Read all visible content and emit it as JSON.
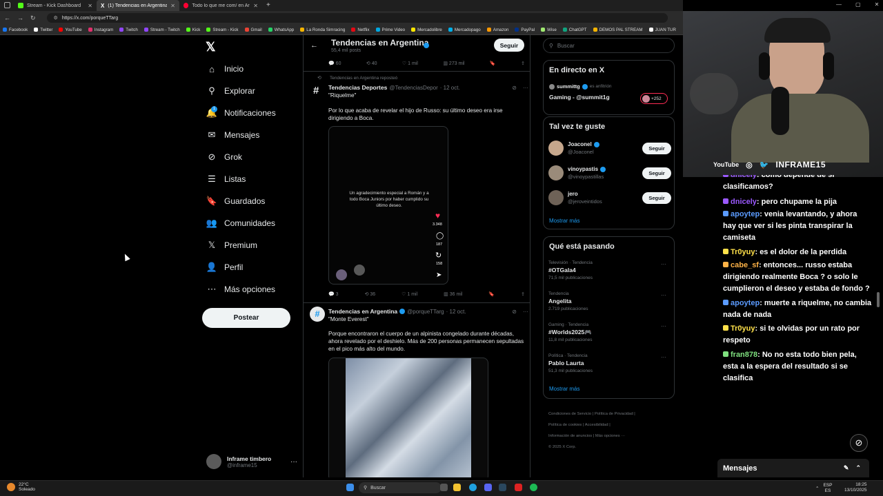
{
  "browser": {
    "tabs": [
      {
        "label": "Stream - Kick Dashboard",
        "color": "#53fc18"
      },
      {
        "label": "(1) Tendencias en Argentina (@p...",
        "color": "#ffffff"
      },
      {
        "label": "Todo lo que me com/ en Argentin...",
        "color": "#ff0033"
      }
    ],
    "new_tab": "+",
    "url": "https://x.com/porqueTTarg",
    "bookmarks": [
      {
        "label": "Facebook",
        "color": "#1877f2"
      },
      {
        "label": "Twitter",
        "color": "#ffffff"
      },
      {
        "label": "YouTube",
        "color": "#ff0000"
      },
      {
        "label": "Instagram",
        "color": "#e1306c"
      },
      {
        "label": "Twitch",
        "color": "#9146ff"
      },
      {
        "label": "Stream - Twitch",
        "color": "#9146ff"
      },
      {
        "label": "Kick",
        "color": "#53fc18"
      },
      {
        "label": "Stream - Kick",
        "color": "#53fc18"
      },
      {
        "label": "Gmail",
        "color": "#ea4335"
      },
      {
        "label": "WhatsApp",
        "color": "#25d366"
      },
      {
        "label": "La Ronda Simracing",
        "color": "#f4b400"
      },
      {
        "label": "Netflix",
        "color": "#e50914"
      },
      {
        "label": "Prime Video",
        "color": "#00a8e1"
      },
      {
        "label": "Mercadolibre",
        "color": "#ffe600"
      },
      {
        "label": "Mercadopago",
        "color": "#00b1ea"
      },
      {
        "label": "Amazon",
        "color": "#ff9900"
      },
      {
        "label": "PayPal",
        "color": "#003087"
      },
      {
        "label": "Wise",
        "color": "#9fe870"
      },
      {
        "label": "ChatGPT",
        "color": "#10a37f"
      },
      {
        "label": "DEMOS PAL STREAM",
        "color": "#f4b400"
      },
      {
        "label": "JUAN TUR",
        "color": "#ffffff"
      }
    ]
  },
  "nav": {
    "items": [
      {
        "label": "Inicio",
        "icon": "⌂"
      },
      {
        "label": "Explorar",
        "icon": "⚲"
      },
      {
        "label": "Notificaciones",
        "icon": "🔔"
      },
      {
        "label": "Mensajes",
        "icon": "✉"
      },
      {
        "label": "Grok",
        "icon": "⊘"
      },
      {
        "label": "Listas",
        "icon": "☰"
      },
      {
        "label": "Guardados",
        "icon": "🔖"
      },
      {
        "label": "Comunidades",
        "icon": "👥"
      },
      {
        "label": "Premium",
        "icon": "𝕏"
      },
      {
        "label": "Perfil",
        "icon": "👤"
      },
      {
        "label": "Más opciones",
        "icon": "⋯"
      }
    ],
    "notification_badge": "1",
    "post_button": "Postear",
    "profile": {
      "name": "Inframe timbero",
      "handle": "@inframe15"
    }
  },
  "timeline": {
    "title": "Tendencias en Argentina",
    "subtitle": "55,4 mil posts",
    "follow": "Seguir",
    "top_actions": {
      "replies": "60",
      "reposts": "40",
      "likes": "1 mil",
      "views": "273 mil"
    },
    "repost_label": "Tendencias en Argentina reposteó",
    "tweet1": {
      "author": "Tendencias Deportes",
      "handle": "@TendenciasDepor",
      "date": "· 12 oct.",
      "topic": "\"Riquelme\"",
      "text": "Por lo que acaba de revelar el hijo de Russo: su último deseo era irse dirigiendo a Boca.",
      "video_caption": "Un agradecimiento especial a Román y a todo Boca Juniors por haber cumplido su último deseo.",
      "video_likes": "3.348",
      "video_comments": "187",
      "video_shares": "158",
      "actions": {
        "replies": "3",
        "reposts": "36",
        "likes": "1 mil",
        "views": "36 mil"
      }
    },
    "tweet2": {
      "author": "Tendencias en Argentina",
      "handle": "@porqueTTarg",
      "date": "· 12 oct.",
      "topic": "\"Monte Everest\"",
      "text": "Porque encontraron el cuerpo de un alpinista congelado durante décadas, ahora revelado por el deshielo. Más de 200 personas permanecen sepultadas en el pico más alto del mundo."
    }
  },
  "sidebar": {
    "search_placeholder": "Buscar",
    "live": {
      "title": "En directo en X",
      "host": "summittg",
      "host_status": "es anfitrión",
      "stream": "Gaming - @summit1g",
      "listeners": "+252"
    },
    "suggest": {
      "title": "Tal vez te guste",
      "users": [
        {
          "name": "Joaconel",
          "handle": "@Joaconel",
          "verified": true
        },
        {
          "name": "vinoypastis",
          "handle": "@vinoypastillas",
          "verified": true
        },
        {
          "name": "jero",
          "handle": "@jeroveintidos",
          "verified": false
        }
      ],
      "follow": "Seguir",
      "more": "Mostrar más"
    },
    "trends": {
      "title": "Qué está pasando",
      "items": [
        {
          "category": "Televisión · Tendencia",
          "name": "#OTGala4",
          "count": "71,5 mil publicaciones"
        },
        {
          "category": "Tendencia",
          "name": "Angelita",
          "count": "2.719 publicaciones"
        },
        {
          "category": "Gaming · Tendencia",
          "name": "#Worlds2025🎮",
          "count": "11,8 mil publicaciones"
        },
        {
          "category": "Política · Tendencia",
          "name": "Pablo Laurta",
          "count": "51,3 mil publicaciones"
        }
      ],
      "more": "Mostrar más"
    },
    "footer": [
      "Condiciones de Servicio",
      "Política de Privacidad",
      "Política de cookies",
      "Accesibilidad",
      "Información de anuncios",
      "Más opciones ···",
      "© 2025 X Corp."
    ]
  },
  "stream": {
    "socials": [
      "YouTube",
      "◎",
      "🐦"
    ],
    "channel": "INFRAME15",
    "chat": [
      {
        "user": "dnicely",
        "color": "#9b59ff",
        "text": ": como depende de si clasificamos?"
      },
      {
        "user": "dnicely",
        "color": "#9b59ff",
        "text": ": pero chupame la pija"
      },
      {
        "user": "apoytep",
        "color": "#5b9bff",
        "text": ": venia levantando, y ahora hay que ver si les pinta transpirar la camiseta"
      },
      {
        "user": "Tr0yuy",
        "color": "#ffe14a",
        "text": ": es el dolor de la perdida"
      },
      {
        "user": "cabe_sf",
        "color": "#ffb347",
        "text": ": entonces... russo estaba dirigiendo realmente Boca ? o solo le cumplieron el deseo y estaba de fondo ?"
      },
      {
        "user": "apoytep",
        "color": "#5b9bff",
        "text": ": muerte a riquelme, no cambia nada de nada"
      },
      {
        "user": "Tr0yuy",
        "color": "#ffe14a",
        "text": ": si te olvidas por un rato por respeto"
      },
      {
        "user": "fran878",
        "color": "#7fe07f",
        "text": ": No no esta todo bien pela, esta a la espera del resultado si se clasifica"
      }
    ],
    "messages_panel": "Mensajes"
  },
  "taskbar": {
    "temp": "22°C",
    "weather": "Soleado",
    "search": "Buscar",
    "lang": "ESP",
    "lang2": "ES",
    "time": "18:25",
    "date": "13/10/2025"
  }
}
